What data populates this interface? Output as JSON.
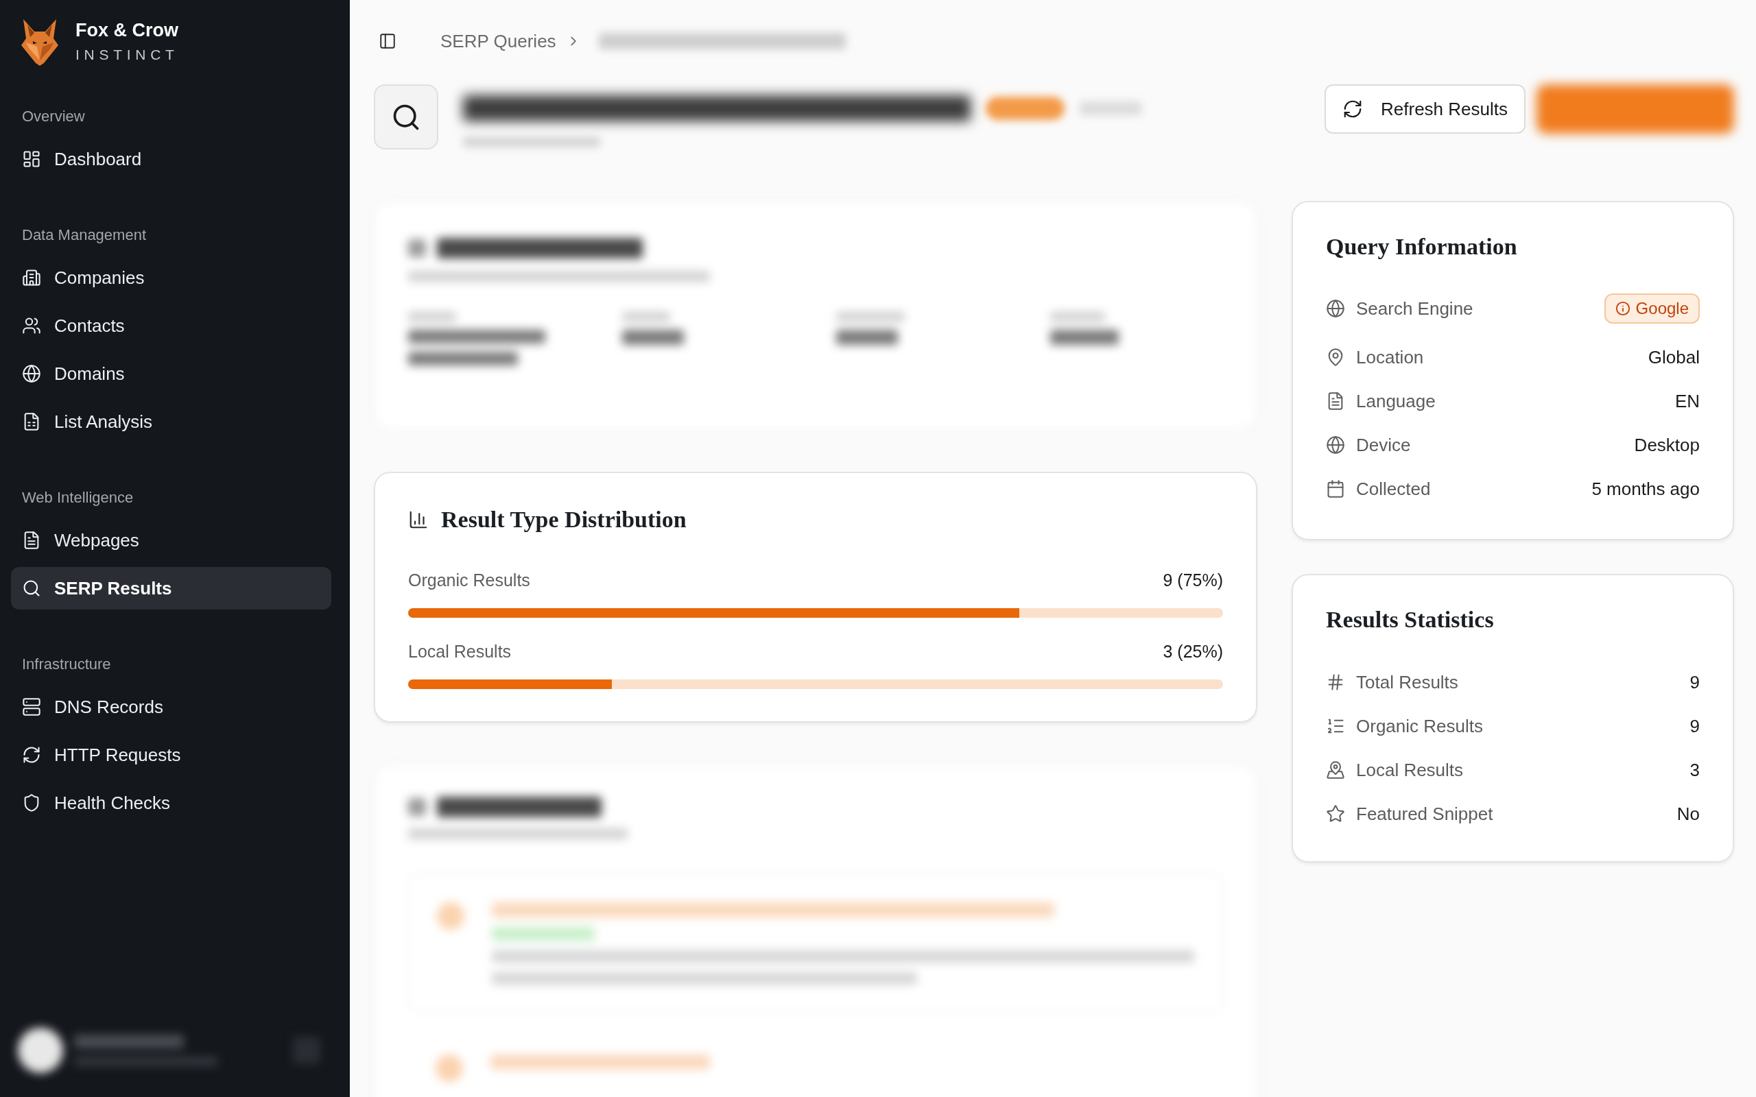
{
  "sidebar": {
    "brand": {
      "name": "Fox & Crow",
      "tagline": "INSTINCT"
    },
    "sections": [
      {
        "title": "Overview",
        "items": [
          {
            "label": "Dashboard",
            "selected": false
          }
        ]
      },
      {
        "title": "Data Management",
        "items": [
          {
            "label": "Companies",
            "selected": false
          },
          {
            "label": "Contacts",
            "selected": false
          },
          {
            "label": "Domains",
            "selected": false
          },
          {
            "label": "List Analysis",
            "selected": false
          }
        ]
      },
      {
        "title": "Web Intelligence",
        "items": [
          {
            "label": "Webpages",
            "selected": false
          },
          {
            "label": "SERP Results",
            "selected": true
          }
        ]
      },
      {
        "title": "Infrastructure",
        "items": [
          {
            "label": "DNS Records",
            "selected": false
          },
          {
            "label": "HTTP Requests",
            "selected": false
          },
          {
            "label": "Health Checks",
            "selected": false
          }
        ]
      }
    ]
  },
  "breadcrumb": [
    {
      "label": "SERP Queries"
    }
  ],
  "actions": [
    {
      "label": "Refresh Results"
    }
  ],
  "result_type_distribution": {
    "title": "Result Type Distribution",
    "rows": [
      {
        "label": "Organic Results",
        "value": "9 (75%)",
        "level": 0.75
      },
      {
        "label": "Local Results",
        "value": "3 (25%)",
        "level": 0.25
      }
    ]
  },
  "query_information": {
    "title": "Query Information",
    "rows": [
      {
        "label": "Search Engine",
        "value": "Google",
        "kind": "badge"
      },
      {
        "label": "Location",
        "value": "Global",
        "kind": "text"
      },
      {
        "label": "Language",
        "value": "EN",
        "kind": "text"
      },
      {
        "label": "Device",
        "value": "Desktop",
        "kind": "text"
      },
      {
        "label": "Collected",
        "value": "5 months ago",
        "kind": "text"
      }
    ]
  },
  "results_statistics": {
    "title": "Results Statistics",
    "rows": [
      {
        "label": "Total Results",
        "value": "9"
      },
      {
        "label": "Organic Results",
        "value": "9"
      },
      {
        "label": "Local Results",
        "value": "3"
      },
      {
        "label": "Featured Snippet",
        "value": "No"
      }
    ]
  }
}
